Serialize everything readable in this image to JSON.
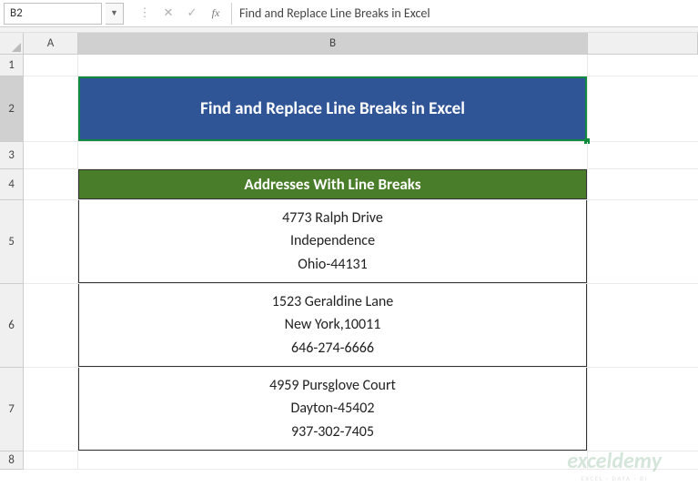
{
  "name_box": "B2",
  "formula": "Find and Replace Line Breaks in Excel",
  "columns": {
    "a": "A",
    "b": "B"
  },
  "rows": {
    "r1": "1",
    "r2": "2",
    "r3": "3",
    "r4": "4",
    "r5": "5",
    "r6": "6",
    "r7": "7",
    "r8": "8"
  },
  "title": "Find and Replace Line Breaks in Excel",
  "table_header": "Addresses With Line Breaks",
  "addresses": [
    {
      "line1": "4773 Ralph Drive",
      "line2": "Independence",
      "line3": "Ohio-44131"
    },
    {
      "line1": "1523 Geraldine Lane",
      "line2": "New York,10011",
      "line3": "646-274-6666"
    },
    {
      "line1": "4959 Pursglove Court",
      "line2": "Dayton-45402",
      "line3": "937-302-7405"
    }
  ],
  "watermark": {
    "brand": "exceldemy",
    "tagline": "EXCEL · DATA · BI"
  },
  "icons": {
    "dots": "⋮",
    "cancel": "✕",
    "enter": "✓",
    "fx": "fx",
    "dd": "▼"
  }
}
